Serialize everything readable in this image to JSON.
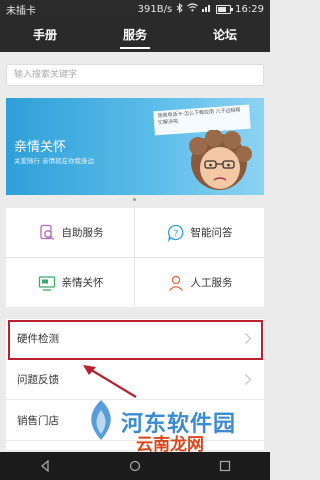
{
  "status_bar": {
    "carrier": "未插卡",
    "net_speed": "391B/s",
    "time": "16:29",
    "battery_level_pct": 75
  },
  "nav": {
    "tabs": [
      {
        "label": "手册"
      },
      {
        "label": "服务"
      },
      {
        "label": "论坛"
      }
    ],
    "active": 1
  },
  "search": {
    "placeholder": "输入搜索关键字"
  },
  "banner": {
    "title": "亲情关怀",
    "subtitle": "关爱随行 亲情就在你我身边",
    "note": "爸爸电话卡·怎么下载应用 儿子远程帮忙解决啦"
  },
  "services": [
    {
      "label": "自助服务",
      "icon": "magnifier-doc-icon"
    },
    {
      "label": "智能问答",
      "icon": "question-bubble-icon"
    },
    {
      "label": "亲情关怀",
      "icon": "monitor-icon"
    },
    {
      "label": "人工服务",
      "icon": "person-icon"
    }
  ],
  "list": [
    {
      "label": "硬件检测"
    },
    {
      "label": "问题反馈"
    },
    {
      "label": "销售门店"
    }
  ],
  "watermark": {
    "main": "河东软件园",
    "sub": "云南龙网"
  },
  "colors": {
    "accent": "#2f9fd8",
    "highlight": "#b8212f",
    "orange_icon": "#e8673a"
  }
}
